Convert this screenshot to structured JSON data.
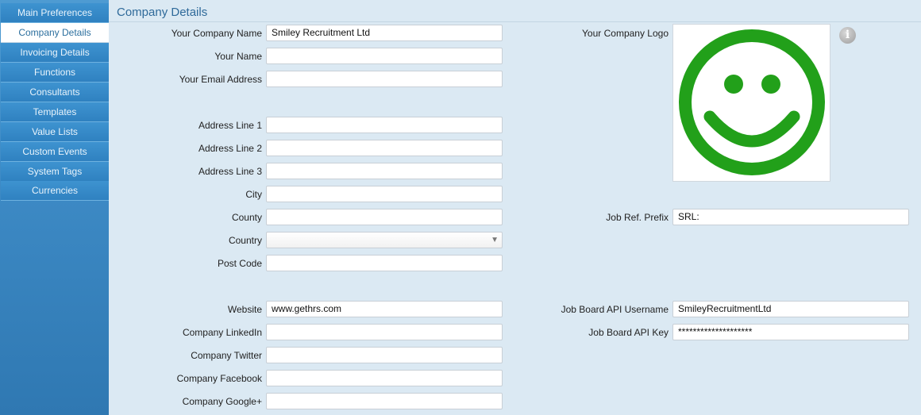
{
  "sidebar": {
    "items": [
      {
        "label": "Main Preferences",
        "active": false
      },
      {
        "label": "Company Details",
        "active": true
      },
      {
        "label": "Invoicing Details",
        "active": false
      },
      {
        "label": "Functions",
        "active": false
      },
      {
        "label": "Consultants",
        "active": false
      },
      {
        "label": "Templates",
        "active": false
      },
      {
        "label": "Value Lists",
        "active": false
      },
      {
        "label": "Custom Events",
        "active": false
      },
      {
        "label": "System Tags",
        "active": false
      },
      {
        "label": "Currencies",
        "active": false
      }
    ]
  },
  "page": {
    "title": "Company Details"
  },
  "form": {
    "company_name": {
      "label": "Your Company Name",
      "value": "Smiley Recruitment Ltd"
    },
    "your_name": {
      "label": "Your Name",
      "value": ""
    },
    "email": {
      "label": "Your Email Address",
      "value": ""
    },
    "address1": {
      "label": "Address Line 1",
      "value": ""
    },
    "address2": {
      "label": "Address Line 2",
      "value": ""
    },
    "address3": {
      "label": "Address Line 3",
      "value": ""
    },
    "city": {
      "label": "City",
      "value": ""
    },
    "county": {
      "label": "County",
      "value": ""
    },
    "country": {
      "label": "Country",
      "value": ""
    },
    "postcode": {
      "label": "Post Code",
      "value": ""
    },
    "website": {
      "label": "Website",
      "value": "www.gethrs.com"
    },
    "linkedin": {
      "label": "Company LinkedIn",
      "value": ""
    },
    "twitter": {
      "label": "Company Twitter",
      "value": ""
    },
    "facebook": {
      "label": "Company Facebook",
      "value": ""
    },
    "googleplus": {
      "label": "Company Google+",
      "value": ""
    },
    "logo": {
      "label": "Your Company Logo",
      "image": "smiley-face-icon",
      "color": "#22a01a"
    },
    "job_ref_prefix": {
      "label": "Job Ref. Prefix",
      "value": "SRL:"
    },
    "api_username": {
      "label": "Job Board API Username",
      "value": "SmileyRecruitmentLtd"
    },
    "api_key": {
      "label": "Job Board API Key",
      "value": "********************"
    }
  },
  "icons": {
    "info": "info-icon",
    "select_arrow": "chevron-down-icon"
  },
  "colors": {
    "sidebar": "#3d8ac5",
    "title": "#2f6a9a",
    "background": "#dbe9f3",
    "logo_green": "#22a01a"
  }
}
